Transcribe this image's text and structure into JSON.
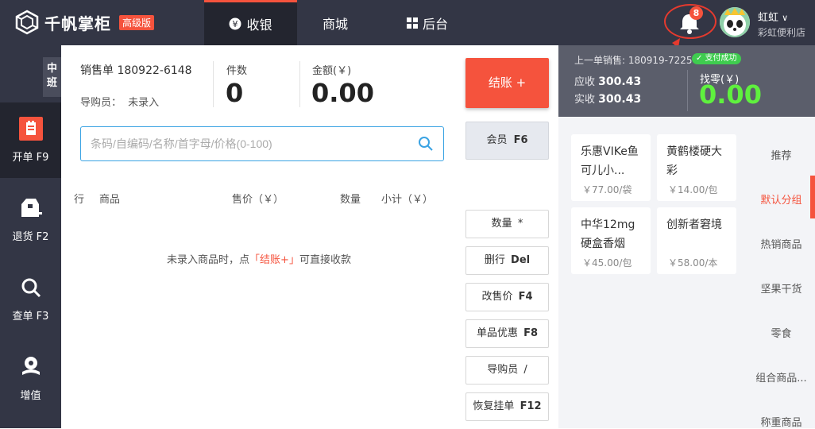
{
  "header": {
    "brand": "千帆掌柜",
    "edition_badge": "高级版",
    "tabs": [
      {
        "label": "收银",
        "icon": "yen-circle-icon"
      },
      {
        "label": "商城",
        "icon": ""
      },
      {
        "label": "后台",
        "icon": "grid-icon"
      }
    ],
    "notification_count": "8",
    "user_name": "虹虹",
    "store_name": "彩虹便利店"
  },
  "sidebar": {
    "shift": "中班",
    "items": [
      {
        "label": "开单 F9",
        "icon": "order-icon"
      },
      {
        "label": "退货 F2",
        "icon": "return-box-icon"
      },
      {
        "label": "查单 F3",
        "icon": "search-icon"
      },
      {
        "label": "增值",
        "icon": "value-added-icon"
      }
    ]
  },
  "sale": {
    "order_label": "销售单 180922-6148",
    "guide_label": "导购员：",
    "guide_value": "未录入",
    "count_label": "件数",
    "count_value": "0",
    "amount_label": "金额(￥)",
    "amount_value": "0.00"
  },
  "search": {
    "placeholder": "条码/自编码/名称/首字母/价格(0-100)"
  },
  "table": {
    "columns": [
      "行",
      "商品",
      "售价（￥）",
      "数量",
      "小计（￥）"
    ],
    "empty_before": "未录入商品时，点",
    "empty_highlight": "「结账+」",
    "empty_after": "可直接收款"
  },
  "actions": {
    "checkout": "结账 +",
    "member": "会员",
    "member_key": "F6",
    "buttons": [
      {
        "label": "数量",
        "key": "*"
      },
      {
        "label": "删行",
        "key": "Del"
      },
      {
        "label": "改售价",
        "key": "F4"
      },
      {
        "label": "单品优惠",
        "key": "F8"
      },
      {
        "label": "导购员",
        "key": "/"
      },
      {
        "label": "恢复挂单",
        "key": "F12"
      }
    ]
  },
  "last_sale": {
    "label": "上一单销售: 180919-7225",
    "status": "✓ 支付成功",
    "receivable_label": "应收",
    "receivable": "300.43",
    "received_label": "实收",
    "received": "300.43",
    "change_label": "找零(￥)",
    "change": "0.00"
  },
  "products": [
    {
      "name": "乐惠VIKe鱼可儿小...",
      "price": "￥77.00/袋"
    },
    {
      "name": "黄鹤楼硬大彩",
      "price": "￥14.00/包"
    },
    {
      "name": "中华12mg硬盒香烟",
      "price": "￥45.00/包"
    },
    {
      "name": "创新者窘境",
      "price": "￥58.00/本"
    }
  ],
  "categories": [
    "推荐",
    "默认分组",
    "热销商品",
    "坚果干货",
    "零食",
    "组合商品...",
    "称重商品"
  ],
  "colors": {
    "accent": "#f5533d",
    "header": "#333645",
    "success": "#3fcc4f",
    "change": "#5ff03e"
  }
}
